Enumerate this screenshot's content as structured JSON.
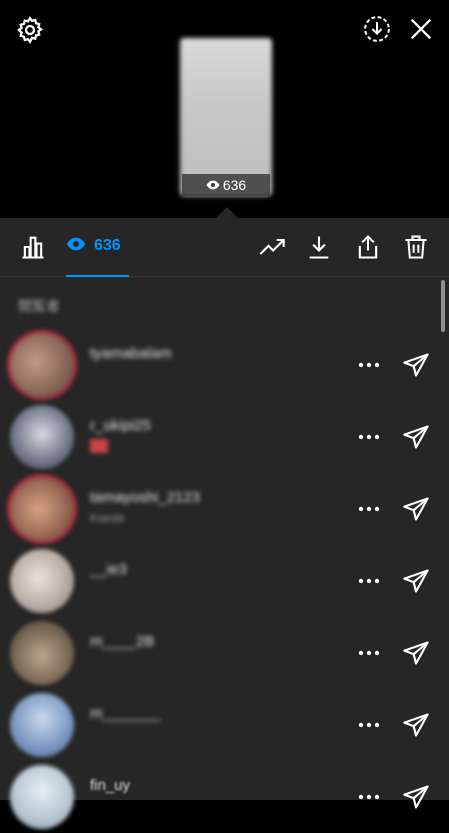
{
  "header": {
    "settings_icon": "gear-icon",
    "download_story_icon": "download-circle-icon",
    "close_icon": "close-icon",
    "thumbnail_view_count": "636"
  },
  "toolbar": {
    "insights_icon": "bar-chart-icon",
    "views_count": "636",
    "promote_icon": "trending-up-icon",
    "save_icon": "download-icon",
    "share_icon": "share-icon",
    "delete_icon": "trash-icon",
    "accent_color": "#0095f6"
  },
  "viewers": {
    "section_label": "閲覧者",
    "items": [
      {
        "username": "tyamabalam",
        "subtitle": "",
        "avatar_color": "#8a6a5a",
        "ring": true
      },
      {
        "username": "r_ukipi25",
        "subtitle": "",
        "avatar_color": "#6f7588",
        "ring": false
      },
      {
        "username": "tamayoshi_2123",
        "subtitle": "Kaede",
        "avatar_color": "#9a6b56",
        "ring": true
      },
      {
        "username": "__ie3",
        "subtitle": "",
        "avatar_color": "#b8aea6",
        "ring": false
      },
      {
        "username": "m____2B",
        "subtitle": "",
        "avatar_color": "#7d6a58",
        "ring": false
      },
      {
        "username": "m_______",
        "subtitle": "",
        "avatar_color": "#7f9bc4",
        "ring": false
      },
      {
        "username": "fin_uy",
        "subtitle": "",
        "avatar_color": "#b9c8d2",
        "ring": false
      }
    ]
  }
}
